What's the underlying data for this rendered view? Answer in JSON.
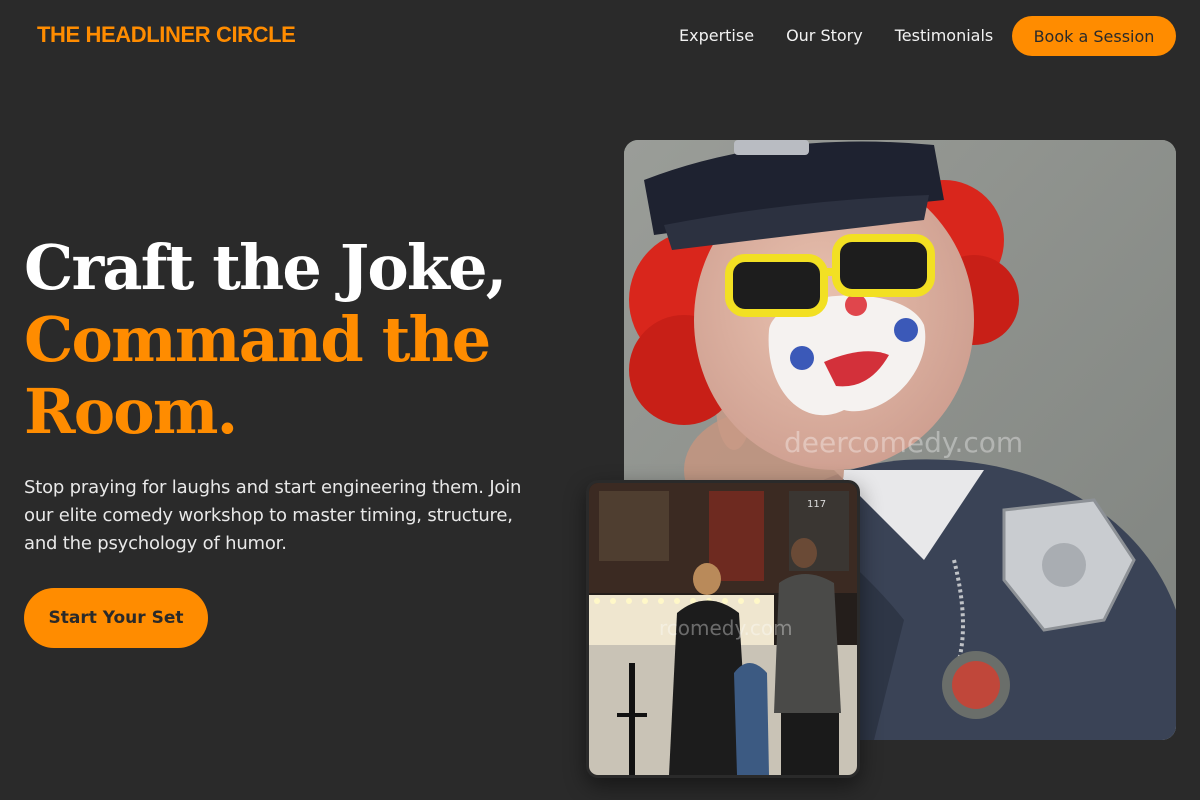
{
  "brand": "THE HEADLINER CIRCLE",
  "nav": {
    "links": [
      "Expertise",
      "Our Story",
      "Testimonials"
    ],
    "cta_label": "Book a Session"
  },
  "hero": {
    "title_line1": "Craft the Joke,",
    "title_accent": "Command the Room.",
    "subtitle": "Stop praying for laughs and start engineering them. Join our elite comedy workshop to master timing, structure, and the psychology of humor.",
    "cta_label": "Start Your Set"
  },
  "images": {
    "main_watermark": "deercomedy.com",
    "small_watermark": "rcomedy.com",
    "small_door_number": "117"
  },
  "colors": {
    "background": "#2a2a2a",
    "accent": "#ff8c00",
    "text": "#ffffff"
  }
}
